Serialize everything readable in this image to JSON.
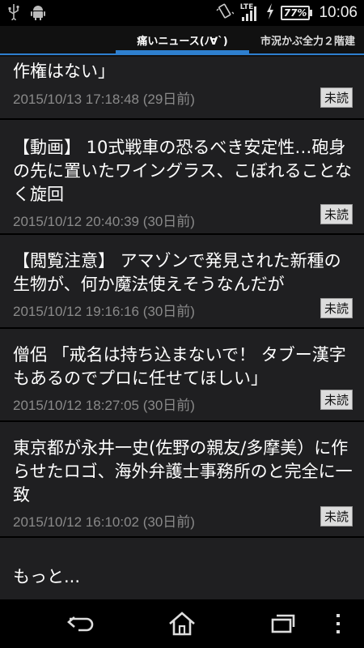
{
  "status_bar": {
    "icons_left": [
      "usb-icon",
      "android-icon"
    ],
    "icons_right": [
      "vibrate-icon",
      "signal-icon",
      "charging-icon"
    ],
    "network": "LTE",
    "battery": "77%",
    "time": "10:06"
  },
  "tabs": {
    "active": "痛いニュース(ﾉ∀`)",
    "next": "市況かぶ全力２階建"
  },
  "articles": [
    {
      "title": "作権はない」",
      "date": "2015/10/13 17:18:48 (29日前)",
      "badge": "未読"
    },
    {
      "title": "【動画】 10式戦車の恐るべき安定性…砲身の先に置いたワイングラス、こぼれることなく旋回",
      "date": "2015/10/12 20:40:39 (30日前)",
      "badge": "未読"
    },
    {
      "title": "【閲覧注意】 アマゾンで発見された新種の生物が、何か魔法使えそうなんだが",
      "date": "2015/10/12 19:16:16 (30日前)",
      "badge": "未読"
    },
    {
      "title": "僧侶 「戒名は持ち込まないで！ タブー漢字もあるのでプロに任せてほしい」",
      "date": "2015/10/12 18:27:05 (30日前)",
      "badge": "未読"
    },
    {
      "title": "東京都が永井一史(佐野の親友/多摩美）に作らせたロゴ、海外弁護士事務所のと完全に一致",
      "date": "2015/10/12 16:10:02 (30日前)",
      "badge": "未読"
    }
  ],
  "more_label": "もっと...",
  "nav": [
    "back-icon",
    "home-icon",
    "recent-apps-icon",
    "overflow-menu-icon"
  ],
  "colors": {
    "accent": "#2e7fcf",
    "badge_bg": "#dcdcdc",
    "date_text": "#8a8a8a"
  }
}
